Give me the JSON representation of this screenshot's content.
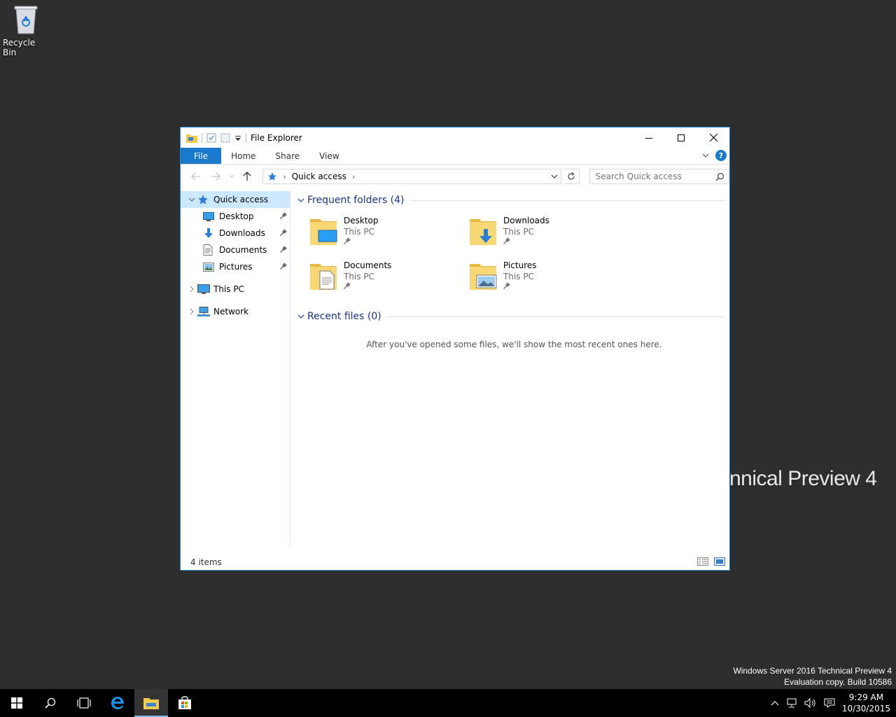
{
  "desktop": {
    "recycle_bin_label": "Recycle Bin",
    "wallpaper_text": "nnical Preview 4",
    "watermark_line1": "Windows Server 2016 Technical Preview 4",
    "watermark_line2": "Evaluation copy. Build 10586"
  },
  "window": {
    "title": "File Explorer",
    "ribbon_tabs": [
      "File",
      "Home",
      "Share",
      "View"
    ],
    "help_label": "?"
  },
  "address": {
    "crumb": "Quick access"
  },
  "search": {
    "placeholder": "Search Quick access"
  },
  "navpane": {
    "quick_access": "Quick access",
    "pinned": [
      {
        "label": "Desktop",
        "icon": "desktop-icon"
      },
      {
        "label": "Downloads",
        "icon": "downloads-icon"
      },
      {
        "label": "Documents",
        "icon": "documents-icon"
      },
      {
        "label": "Pictures",
        "icon": "pictures-icon"
      }
    ],
    "this_pc": "This PC",
    "network": "Network"
  },
  "content": {
    "frequent_title": "Frequent folders (4)",
    "folders": [
      {
        "name": "Desktop",
        "location": "This PC"
      },
      {
        "name": "Downloads",
        "location": "This PC"
      },
      {
        "name": "Documents",
        "location": "This PC"
      },
      {
        "name": "Pictures",
        "location": "This PC"
      }
    ],
    "recent_title": "Recent files (0)",
    "recent_empty": "After you've opened some files, we'll show the most recent ones here."
  },
  "status": {
    "items": "4 items"
  },
  "taskbar": {
    "time": "9:29 AM",
    "date": "10/30/2015"
  },
  "colors": {
    "accent": "#1979ca",
    "group_title": "#1e3287",
    "selection": "#cce8ff",
    "desktop_bg": "#2d2d2d"
  }
}
